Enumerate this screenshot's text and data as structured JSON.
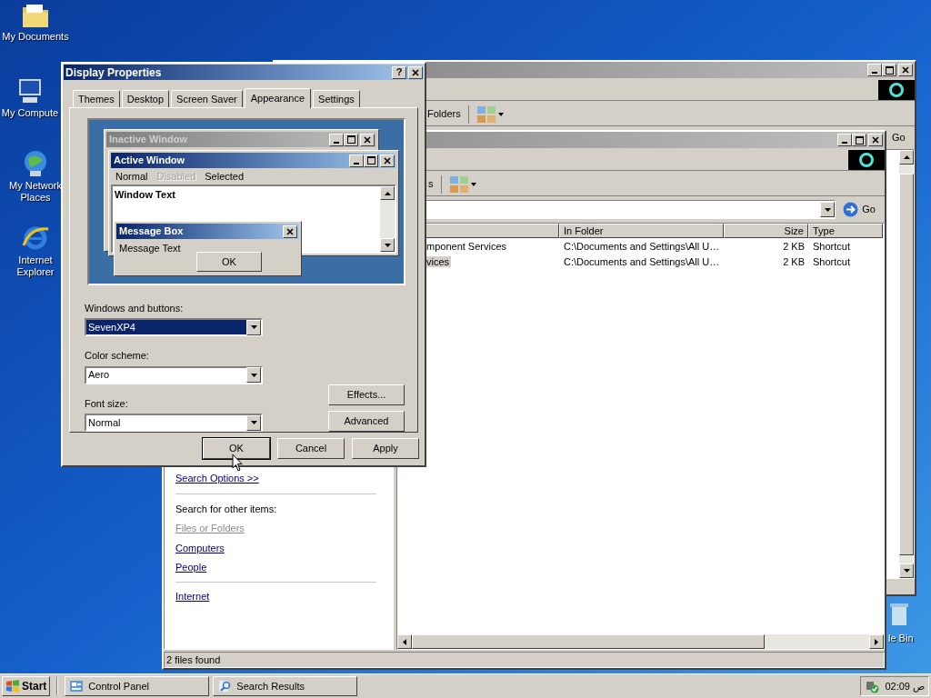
{
  "desktop_icons": [
    {
      "label": "My Documents",
      "kind": "folder"
    },
    {
      "label": "My Compute",
      "kind": "computer"
    },
    {
      "label": "My Network Places",
      "kind": "network"
    },
    {
      "label": "Internet Explorer",
      "kind": "browser"
    }
  ],
  "recycle_bin": {
    "label": "le Bin"
  },
  "control_panel_window": {
    "toolbar_label": "Folders",
    "go_button": "Go"
  },
  "search_window": {
    "toolbar_label": "s",
    "go_button": "Go",
    "columns": [
      {
        "label": "In Folder"
      },
      {
        "label": "Size"
      },
      {
        "label": "Type"
      }
    ],
    "rows": [
      {
        "name": "mponent Services",
        "folder": "C:\\Documents and Settings\\All U…",
        "size": "2 KB",
        "type": "Shortcut",
        "selected": false
      },
      {
        "name": "vices",
        "folder": "C:\\Documents and Settings\\All U…",
        "size": "2 KB",
        "type": "Shortcut",
        "selected": true
      }
    ],
    "search_options_link": "Search Options >>",
    "other_items_heading": "Search for other items:",
    "other_items": [
      {
        "label": "Files or Folders",
        "disabled": true
      },
      {
        "label": "Computers",
        "disabled": false
      },
      {
        "label": "People",
        "disabled": false
      }
    ],
    "internet_link": "Internet",
    "status": "2 files found"
  },
  "display_properties": {
    "title": "Display Properties",
    "help_button": "?",
    "tabs": [
      {
        "label": "Themes",
        "selected": false
      },
      {
        "label": "Desktop",
        "selected": false
      },
      {
        "label": "Screen Saver",
        "selected": false
      },
      {
        "label": "Appearance",
        "selected": true
      },
      {
        "label": "Settings",
        "selected": false
      }
    ],
    "preview": {
      "inactive_title": "Inactive Window",
      "active_title": "Active Window",
      "menu_items": [
        {
          "label": "Normal",
          "disabled": false
        },
        {
          "label": "Disabled",
          "disabled": true
        },
        {
          "label": "Selected",
          "disabled": false
        }
      ],
      "window_text": "Window Text",
      "message_title": "Message Box",
      "message_text": "Message Text",
      "ok_button": "OK"
    },
    "fields": [
      {
        "label": "Windows and buttons:",
        "value": "SevenXP4",
        "highlighted": true
      },
      {
        "label": "Color scheme:",
        "value": "Aero",
        "highlighted": false
      },
      {
        "label": "Font size:",
        "value": "Normal",
        "highlighted": false
      }
    ],
    "side_buttons": [
      "Effects...",
      "Advanced"
    ],
    "buttons": [
      "OK",
      "Cancel",
      "Apply"
    ]
  },
  "taskbar": {
    "start": "Start",
    "tasks": [
      {
        "label": "Control Panel",
        "kind": "control-panel"
      },
      {
        "label": "Search Results",
        "kind": "search"
      }
    ],
    "clock": "02:09 ص"
  }
}
